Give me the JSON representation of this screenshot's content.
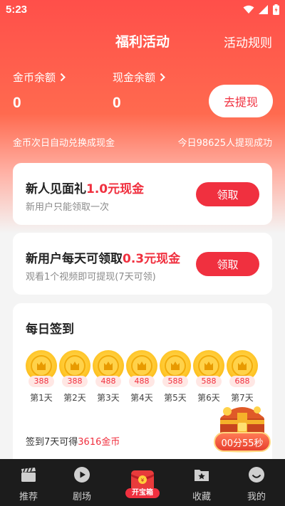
{
  "status_bar": {
    "time": "5:23",
    "icons": [
      "wifi-icon",
      "signal-icon",
      "battery-icon"
    ]
  },
  "header": {
    "title": "福利活动",
    "rules_link": "活动规则"
  },
  "balances": {
    "coin": {
      "label": "金币余额",
      "value": "0"
    },
    "cash": {
      "label": "现金余额",
      "value": "0"
    }
  },
  "withdraw_button": "去提现",
  "hints": {
    "left": "金币次日自动兑换成现金",
    "right": "今日98625人提现成功"
  },
  "tasks": [
    {
      "title": "新人见面礼",
      "amount": "1.0元现金",
      "subtitle": "新用户只能领取一次",
      "button": "领取"
    },
    {
      "title": "新用户每天可领取",
      "amount": "0.3元现金",
      "subtitle": "观看1个视频即可提现(7天可领)",
      "button": "领取"
    }
  ],
  "checkin": {
    "title": "每日签到",
    "days": [
      {
        "amount": "388",
        "label": "第1天"
      },
      {
        "amount": "388",
        "label": "第2天"
      },
      {
        "amount": "488",
        "label": "第3天"
      },
      {
        "amount": "488",
        "label": "第4天"
      },
      {
        "amount": "588",
        "label": "第5天"
      },
      {
        "amount": "588",
        "label": "第6天"
      },
      {
        "amount": "688",
        "label": "第7天"
      }
    ],
    "note_prefix": "签到7天可得",
    "note_highlight": "3616金币"
  },
  "treasure_timer": "00分55秒",
  "tabs": [
    {
      "label": "推荐",
      "icon": "clapperboard-icon"
    },
    {
      "label": "剧场",
      "icon": "play-circle-icon"
    },
    {
      "label": "开宝箱",
      "icon": "treasure-chest-icon"
    },
    {
      "label": "收藏",
      "icon": "star-folder-icon"
    },
    {
      "label": "我的",
      "icon": "smiley-face-icon"
    }
  ],
  "colors": {
    "accent": "#f0303f",
    "hero_top": "#ff4f4a",
    "coin": "#ffc62a",
    "tabbar": "#1c1c1c"
  }
}
